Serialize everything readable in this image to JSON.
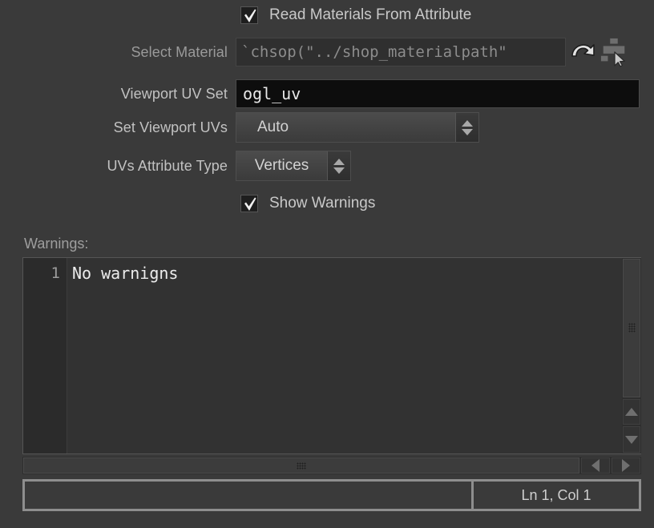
{
  "panel": {
    "read_materials": {
      "label": "Read Materials From Attribute",
      "checked": true,
      "icon": "checkmark-icon"
    },
    "select_material": {
      "label": "Select Material",
      "value": "`chsop(\"../shop_materialpath\"",
      "disabled": true,
      "reload_icon": "curved-arrow-icon",
      "picker_icon": "node-picker-icon"
    },
    "viewport_uv_set": {
      "label": "Viewport UV Set",
      "value": "ogl_uv"
    },
    "set_viewport_uvs": {
      "label": "Set Viewport UVs",
      "value": "Auto",
      "options": [
        "Auto"
      ],
      "arrows_icon": "updown-arrows-icon"
    },
    "uvs_attribute_type": {
      "label": "UVs Attribute Type",
      "value": "Vertices",
      "options": [
        "Vertices"
      ],
      "arrows_icon": "updown-arrows-icon"
    },
    "show_warnings": {
      "label": "Show Warnings",
      "checked": true,
      "icon": "checkmark-icon"
    }
  },
  "warnings": {
    "label": "Warnings:",
    "lines": [
      {
        "number": "1",
        "text": "No warnigns"
      }
    ],
    "line_number": "1",
    "line_text": "No warnigns"
  },
  "scrollbars": {
    "vertical": {
      "up_icon": "triangle-up-icon",
      "down_icon": "triangle-down-icon",
      "grip_icon": "grip-dots-icon"
    },
    "horizontal": {
      "left_icon": "triangle-left-icon",
      "right_icon": "triangle-right-icon",
      "grip_icon": "grip-dots-icon"
    }
  },
  "statusbar": {
    "input_value": "",
    "position": "Ln 1, Col 1"
  },
  "colors": {
    "background": "#3a3a3a",
    "field_dark": "#0d0d0d",
    "field_expr": "#2f2f2f",
    "editor_bg": "#323232",
    "gutter_bg": "#2b2b2b",
    "text": "#c8c8c8",
    "text_dim": "#9a9a9a",
    "border_light": "#8e8e8e"
  }
}
